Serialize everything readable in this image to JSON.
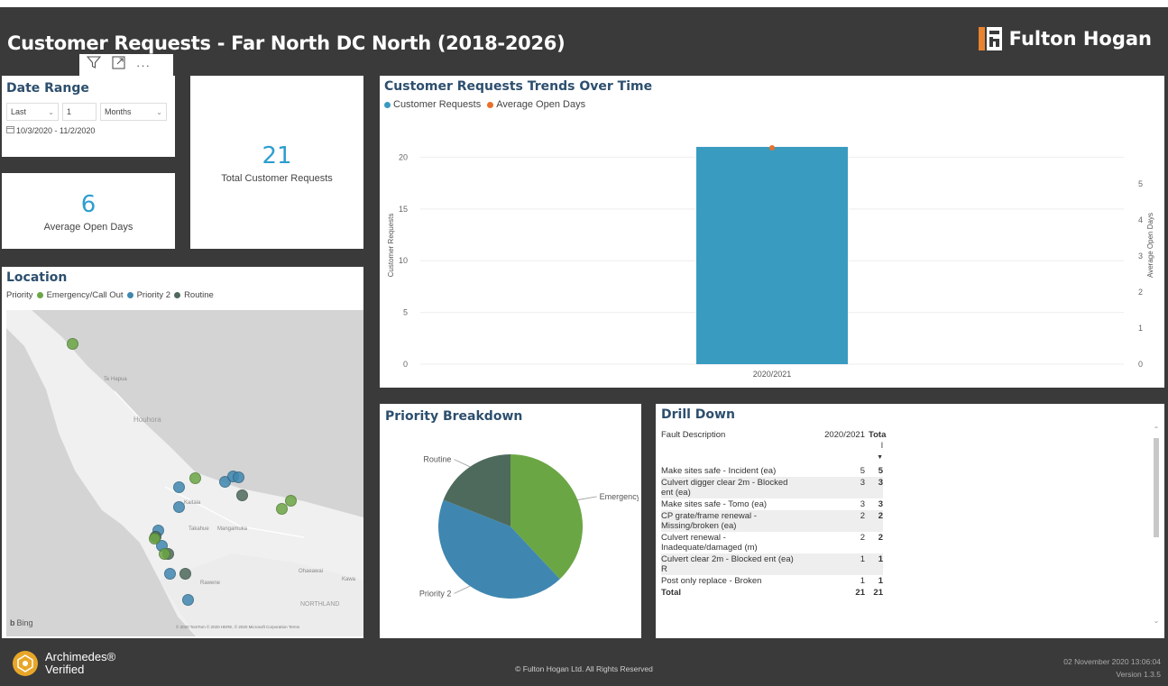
{
  "header": {
    "title": "Customer Requests - Far North DC North (2018-2026)",
    "logo_text": "Fulton Hogan",
    "logo_color": "#e8832f"
  },
  "visual_header": {
    "icons": [
      "filter-icon",
      "focus-mode-icon",
      "more-options-icon"
    ],
    "more_label": "···"
  },
  "date_range": {
    "title": "Date Range",
    "period": "Last",
    "count": "1",
    "unit": "Months",
    "dates": "10/3/2020 - 11/2/2020"
  },
  "kpis": {
    "avg_open_days": {
      "value": "6",
      "label": "Average Open Days"
    },
    "total_requests": {
      "value": "21",
      "label": "Total Customer Requests"
    }
  },
  "location": {
    "title": "Location",
    "legend_prefix": "Priority",
    "legend": [
      {
        "label": "Emergency/Call Out",
        "color": "#6ba644"
      },
      {
        "label": "Priority 2",
        "color": "#3f87b0"
      },
      {
        "label": "Routine",
        "color": "#4e6a5c"
      }
    ],
    "place_labels": [
      "Te Hapua",
      "Houhora",
      "Kaitaia",
      "Takahue",
      "Mangamuka",
      "Ohaeawai",
      "Kawa",
      "NORTHLAND",
      "Rawene"
    ],
    "bing_label": "Bing",
    "map_copyright": "© 2020 TomTom © 2020 HERE, © 2020 Microsoft Corporation Terms"
  },
  "trends": {
    "title": "Customer Requests Trends Over Time",
    "legend": [
      {
        "label": "Customer Requests",
        "color": "#3a9bc1"
      },
      {
        "label": "Average Open Days",
        "color": "#e8702a"
      }
    ]
  },
  "chart_data": [
    {
      "type": "bar",
      "title": "Customer Requests Trends Over Time",
      "categories": [
        "2020/2021"
      ],
      "series": [
        {
          "name": "Customer Requests",
          "values": [
            21
          ],
          "axis": "left",
          "color": "#3a9bc1"
        },
        {
          "name": "Average Open Days",
          "values": [
            6
          ],
          "axis": "right",
          "color": "#e8702a"
        }
      ],
      "ylabel": "Customer Requests",
      "ylabel_right": "Average Open Days",
      "yticks": [
        "0",
        "5",
        "10",
        "15",
        "20"
      ],
      "yticks_right": [
        "0",
        "1",
        "2",
        "3",
        "4",
        "5"
      ],
      "ylim": [
        0,
        23
      ],
      "ylim_right": [
        0,
        6.6
      ]
    },
    {
      "type": "pie",
      "title": "Priority Breakdown",
      "categories": [
        "Emergency/Call...",
        "Priority 2",
        "Routine"
      ],
      "values": [
        38,
        43,
        19
      ],
      "colors": [
        "#6ba644",
        "#3f87b0",
        "#4e6a5c"
      ]
    }
  ],
  "drill_down": {
    "title": "Drill Down",
    "headers": [
      "Fault Description",
      "2020/2021",
      "Tota",
      "l"
    ],
    "rows": [
      [
        "Make sites safe - Incident (ea)",
        "5",
        "5"
      ],
      [
        "Culvert digger clear 2m - Blocked ent (ea)",
        "3",
        "3"
      ],
      [
        "Make sites safe - Tomo (ea)",
        "3",
        "3"
      ],
      [
        "CP grate/frame renewal - Missing/broken (ea)",
        "2",
        "2"
      ],
      [
        "Culvert renewal - Inadequate/damaged (m)",
        "2",
        "2"
      ],
      [
        "Culvert clear 2m - Blocked ent (ea) R",
        "1",
        "1"
      ],
      [
        "Post only replace - Broken",
        "1",
        "1"
      ]
    ],
    "total": [
      "Total",
      "21",
      "21"
    ]
  },
  "footer": {
    "archimedes_line1": "Archimedes®",
    "archimedes_line2": "Verified",
    "copyright": "© Fulton Hogan Ltd. All Rights Reserved",
    "timestamp": "02 November 2020 13:06:04",
    "version": "Version 1.3.5"
  }
}
